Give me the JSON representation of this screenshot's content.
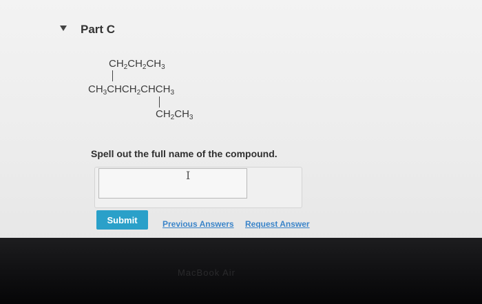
{
  "part": {
    "title": "Part C"
  },
  "structure": {
    "top_chain": "CH2CH2CH3",
    "main_chain": "CH3CHCH2CHCH3",
    "bottom_chain": "CH2CH3"
  },
  "question": {
    "instruction": "Spell out the full name of the compound."
  },
  "answer": {
    "value": "",
    "placeholder": ""
  },
  "actions": {
    "submit_label": "Submit",
    "previous_answers_label": "Previous Answers",
    "request_answer_label": "Request Answer"
  },
  "device": {
    "brand": "MacBook Air"
  },
  "colors": {
    "submit": "#2aa0c9",
    "link": "#3a84c9"
  }
}
